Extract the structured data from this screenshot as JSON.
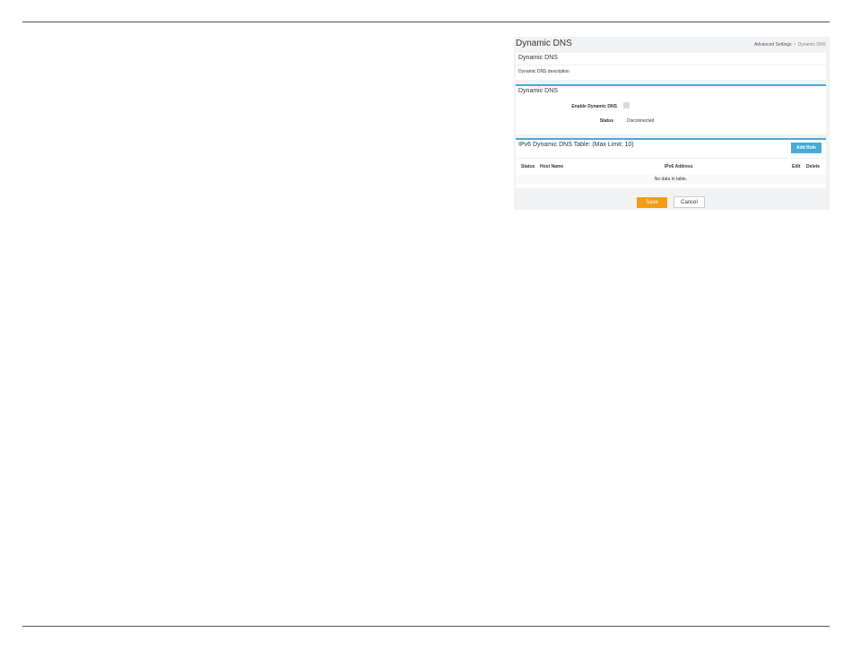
{
  "header": {
    "title": "Dynamic DNS",
    "breadcrumb": {
      "parent": "Advanced Settings",
      "separator": ">",
      "current": "Dynamic DNS"
    }
  },
  "description_card": {
    "title": "Dynamic DNS",
    "text": "Dynamic DNS description"
  },
  "ddns_card": {
    "title": "Dynamic DNS",
    "enable_label": "Enable Dynamic DNS",
    "enable_checked": false,
    "status_label": "Status",
    "status_value": "Disconnected"
  },
  "ipv6_table": {
    "title": "IPv6 Dynamic DNS Table: (Max Limit: 10)",
    "add_button": "Add Rule",
    "columns": [
      "Status",
      "Host Name",
      "IPv6 Address",
      "Edit",
      "Delete"
    ],
    "empty_text": "No data in table."
  },
  "actions": {
    "save": "Save",
    "cancel": "Cancel"
  },
  "colors": {
    "accent": "#4aa9d6",
    "save": "#f39c12",
    "panel_bg": "#f1f2f4"
  }
}
